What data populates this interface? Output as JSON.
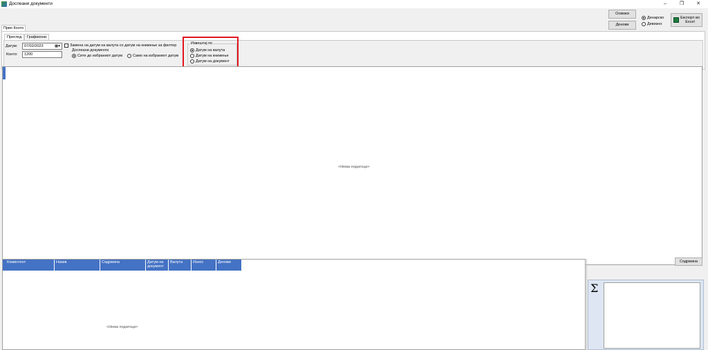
{
  "window": {
    "title": "Доспеани документи",
    "minimize_glyph": "–",
    "restore_glyph": "❐",
    "close_glyph": "✕"
  },
  "toolbar": {
    "osveki_label": "Освежи",
    "denovi_label": "Денови",
    "denarsko_label": "Денарско",
    "devizno_label": "Девизно",
    "export_line1": "Експорт во",
    "export_line2": "Excel"
  },
  "outer_tab": "Прво Конто",
  "tabs": [
    "Преглед",
    "Графикони"
  ],
  "form": {
    "datum_label": "Датум:",
    "datum_value": "07/02/2023",
    "konto_label": "Конто:",
    "konto_value": "1200",
    "zamena_label": "Замена на датум на валута со датум на книжење за филтер",
    "dospeani_label": "Доспеани документи",
    "site_label": "Сите до избраниот датум",
    "samo_label": "Само на избраниот датум"
  },
  "izvestaj": {
    "title": "Извештај по",
    "options": [
      "Датум на валута",
      "Датум на книжење",
      "Датум на документ"
    ]
  },
  "upper_grid": {
    "empty_text": "<Нема податоци>"
  },
  "lower_grid": {
    "columns": [
      "Коминтент",
      "Назив",
      "Содржина",
      "Датум на документ",
      "Валута",
      "Износ",
      "Денови"
    ],
    "empty_text": "<Нема податоци>"
  },
  "sodrzina_label": "Содржина",
  "sigma_glyph": "Σ"
}
